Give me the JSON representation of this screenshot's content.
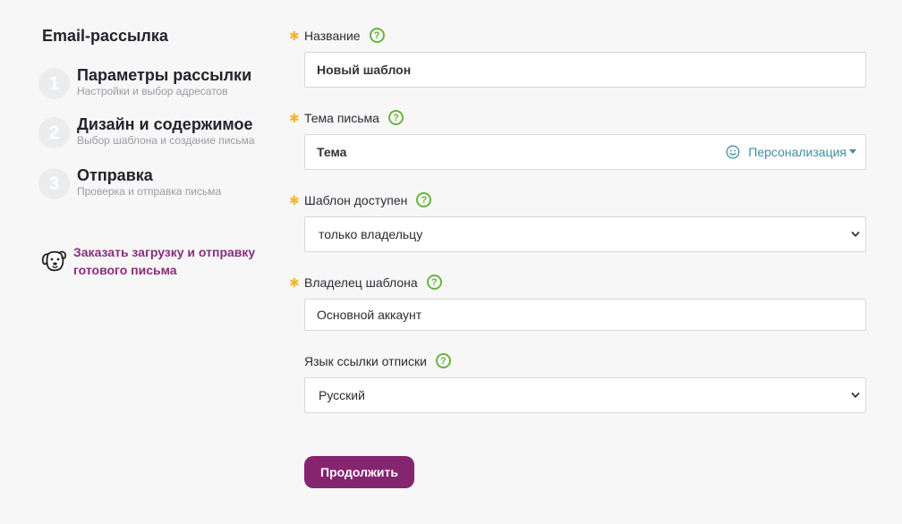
{
  "sidebar": {
    "title": "Email-рассылка",
    "steps": [
      {
        "num": "1",
        "title": "Параметры рассылки",
        "subtitle": "Настройки и выбор адресатов"
      },
      {
        "num": "2",
        "title": "Дизайн и содержимое",
        "subtitle": "Выбор шаблона и создание письма"
      },
      {
        "num": "3",
        "title": "Отправка",
        "subtitle": "Проверка и отправка письма"
      }
    ],
    "order_link": {
      "line1": "Заказать загрузку и отправку",
      "line2": "готового письма"
    }
  },
  "form": {
    "required_mark": "✱",
    "help_mark": "?",
    "name": {
      "label": "Название",
      "value": "Новый шаблон"
    },
    "subject": {
      "label": "Тема письма",
      "value": "Тема",
      "personalize_label": "Персонализация"
    },
    "availability": {
      "label": "Шаблон доступен",
      "selected": "только владельцу"
    },
    "owner": {
      "label": "Владелец шаблона",
      "value": "Основной аккаунт"
    },
    "unsubscribe_lang": {
      "label": "Язык ссылки отписки",
      "selected": "Русский"
    },
    "continue_label": "Продолжить"
  },
  "colors": {
    "accent": "#85246f",
    "link": "#8a2c7b",
    "help": "#6ab33f",
    "required": "#f2b531",
    "personalize": "#3f8fa6"
  }
}
